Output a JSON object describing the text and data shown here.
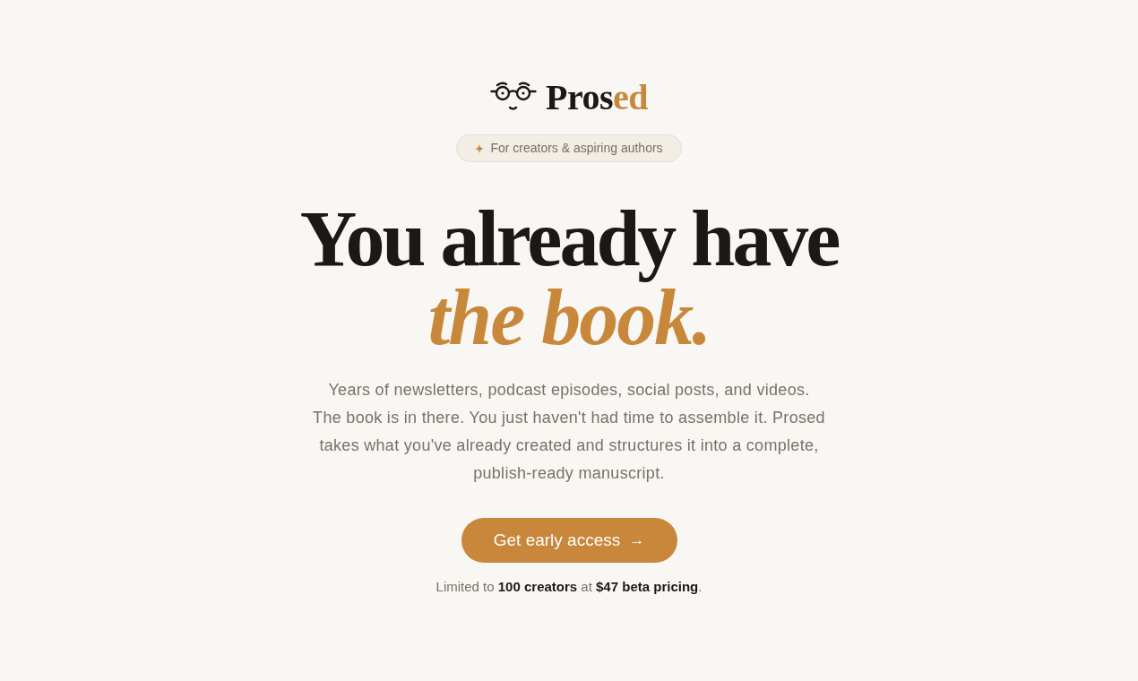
{
  "logo": {
    "parts": [
      {
        "text": "Pros",
        "accent": false
      },
      {
        "text": "ed",
        "accent": true
      }
    ]
  },
  "badge": {
    "label": "For creators & aspiring authors"
  },
  "headline": {
    "lines": [
      {
        "text": "You already have",
        "accent": false
      },
      {
        "text": "the book.",
        "accent": true
      }
    ]
  },
  "description": {
    "lines": [
      "Years of newsletters, podcast episodes, social posts, and videos.",
      "The book is in there. You just haven't had time to assemble it. Prosed",
      "takes what you've already created and structures it into a complete,",
      "publish-ready manuscript."
    ]
  },
  "cta": {
    "label": "Get early access",
    "arrow": "→"
  },
  "note": "Limited to **100 creators** at **$47 beta pricing**."
}
